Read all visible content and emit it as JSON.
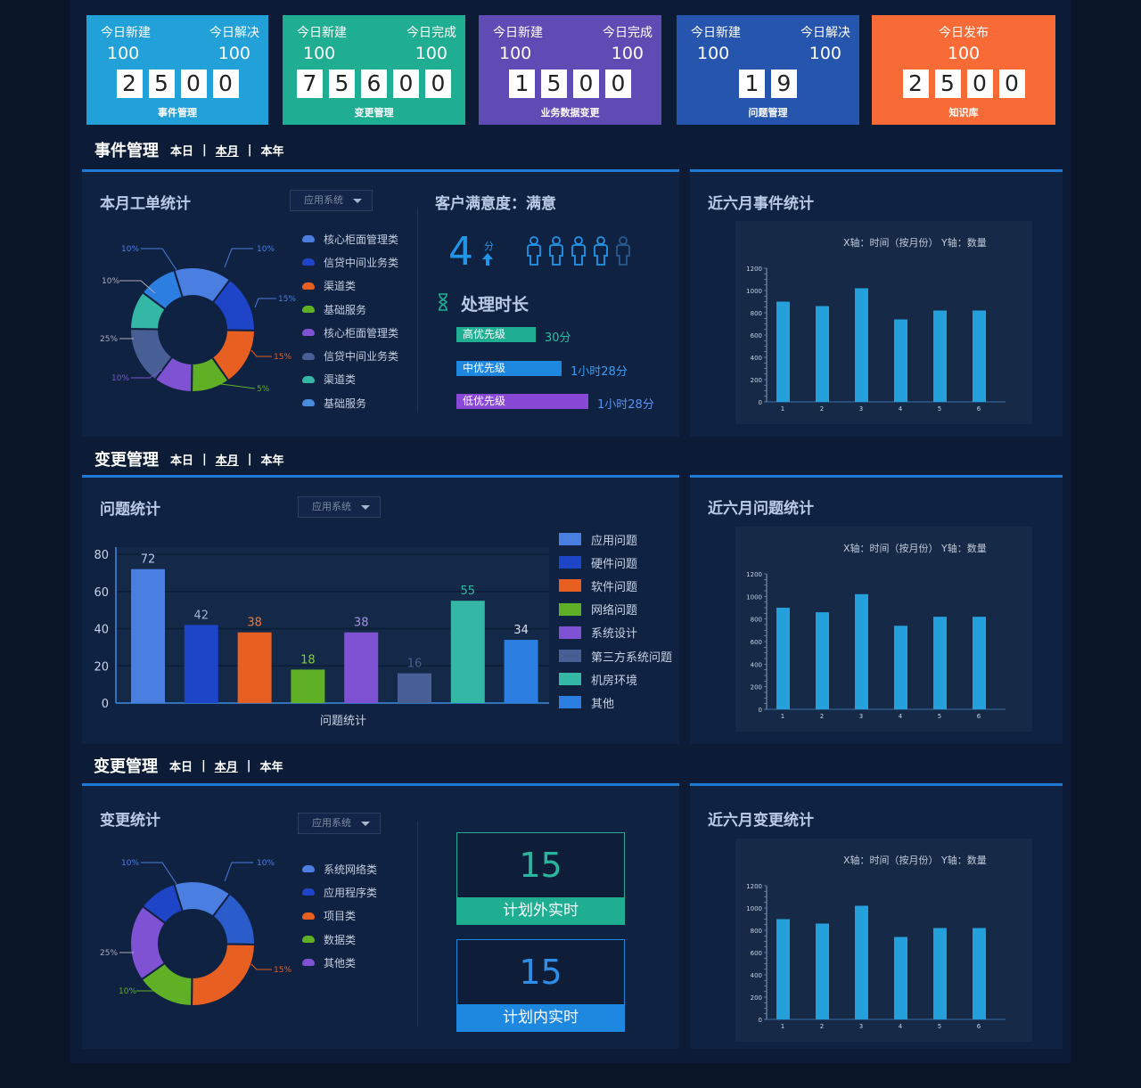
{
  "kpis": [
    {
      "left_label": "今日新建",
      "left_value": "100",
      "right_label": "今日解决",
      "right_value": "100",
      "digits": [
        "2",
        "5",
        "0",
        "0"
      ],
      "name": "事件管理",
      "color": "#22a0d8"
    },
    {
      "left_label": "今日新建",
      "left_value": "100",
      "right_label": "今日完成",
      "right_value": "100",
      "digits": [
        "7",
        "5",
        "6",
        "0",
        "0"
      ],
      "name": "变更管理",
      "color": "#1fae92"
    },
    {
      "left_label": "今日新建",
      "left_value": "100",
      "right_label": "今日完成",
      "right_value": "100",
      "digits": [
        "1",
        "5",
        "0",
        "0"
      ],
      "name": "业务数据变更",
      "color": "#5f4bb4"
    },
    {
      "left_label": "今日新建",
      "left_value": "100",
      "right_label": "今日解决",
      "right_value": "100",
      "digits": [
        "1",
        "9"
      ],
      "name": "问题管理",
      "color": "#2655ad"
    },
    {
      "center_label": "今日发布",
      "center_value": "100",
      "digits": [
        "2",
        "5",
        "0",
        "0"
      ],
      "name": "知识库",
      "color": "#f96b36"
    }
  ],
  "sections": [
    {
      "title": "事件管理",
      "filters": [
        "本日",
        "本月",
        "本年"
      ],
      "active": "本月"
    },
    {
      "title": "变更管理",
      "filters": [
        "本日",
        "本月",
        "本年"
      ],
      "active": "本月"
    },
    {
      "title": "变更管理",
      "filters": [
        "本日",
        "本月",
        "本年"
      ],
      "active": "本月"
    }
  ],
  "icons": {
    "hourglass": "hourglass-icon",
    "person": "person-icon",
    "arrow": "arrow-up-icon"
  },
  "panel1": {
    "title": "本月工单统计",
    "dropdown": "应用系统",
    "donut": {
      "labels": [
        "10%",
        "10%",
        "10%",
        "15%",
        "25%",
        "15%",
        "10%",
        "5%"
      ],
      "legend": [
        {
          "label": "核心柜面管理类",
          "color": "#4a7ee0"
        },
        {
          "label": "信贷中间业务类",
          "color": "#1e44c8"
        },
        {
          "label": "渠道类",
          "color": "#e85f22"
        },
        {
          "label": "基础服务",
          "color": "#60b025"
        },
        {
          "label": "核心柜面管理类",
          "color": "#7e52d2"
        },
        {
          "label": "信贷中间业务类",
          "color": "#485f96"
        },
        {
          "label": "渠道类",
          "color": "#35b7a6"
        },
        {
          "label": "基础服务",
          "color": "#4a8cdc"
        }
      ]
    },
    "satisfaction": {
      "title": "客户满意度：满意",
      "score": "4",
      "unit": "分",
      "people_filled": 4,
      "people_total": 5
    },
    "handling": {
      "title": "处理时长",
      "max": 40,
      "items": [
        {
          "label": "高优先级",
          "value": "30分",
          "minutes": 30,
          "color": "#1fae92",
          "text_color": "#2ac0a4"
        },
        {
          "label": "中优先级",
          "value": "1小时28分",
          "minutes": 40,
          "color": "#1e88e0",
          "text_color": "#3a9cf0"
        },
        {
          "label": "低优先级",
          "value": "1小时28分",
          "minutes": 50,
          "color": "#8a48d6",
          "text_color": "#5a92f0"
        }
      ]
    }
  },
  "panel2": {
    "title": "近六月事件统计",
    "axis_text": "X轴：时间（按月份）  Y轴：数量"
  },
  "panel3": {
    "title": "问题统计",
    "dropdown": "应用系统",
    "legend": [
      {
        "label": "应用问题",
        "color": "#4a7ee0"
      },
      {
        "label": "硬件问题",
        "color": "#1e44c8"
      },
      {
        "label": "软件问题",
        "color": "#e85f22"
      },
      {
        "label": "网络问题",
        "color": "#60b025"
      },
      {
        "label": "系统设计",
        "color": "#7e52d2"
      },
      {
        "label": "第三方系统问题",
        "color": "#485f96"
      },
      {
        "label": "机房环境",
        "color": "#35b7a6"
      },
      {
        "label": "其他",
        "color": "#2c7ee0"
      }
    ]
  },
  "panel4": {
    "title": "近六月问题统计",
    "axis_text": "X轴：时间（按月份）  Y轴：数量"
  },
  "panel5": {
    "title": "变更统计",
    "dropdown": "应用系统",
    "donut": {
      "labels": [
        "10%",
        "10%",
        "25%",
        "15%",
        "10%"
      ],
      "legend": [
        {
          "label": "系统网络类",
          "color": "#4a7ee0"
        },
        {
          "label": "应用程序类",
          "color": "#1e44c8"
        },
        {
          "label": "项目类",
          "color": "#e85f22"
        },
        {
          "label": "数据类",
          "color": "#60b025"
        },
        {
          "label": "其他类",
          "color": "#7e52d2"
        }
      ]
    },
    "box1": {
      "value": "15",
      "label": "计划外实时",
      "color": "#1fae92",
      "num_color": "#2ab59e"
    },
    "box2": {
      "value": "15",
      "label": "计划内实时",
      "color": "#1e88e0",
      "num_color": "#2e8ee8"
    }
  },
  "panel6": {
    "title": "近六月变更统计",
    "axis_text": "X轴：时间（按月份）  Y轴：数量"
  },
  "chart_data": [
    {
      "type": "pie",
      "donut": true,
      "values": [
        15,
        15,
        15,
        10,
        10,
        15,
        10,
        10
      ],
      "labels": [
        "10%",
        "10%",
        "10%",
        "15%",
        "25%",
        "15%",
        "10%",
        "5%"
      ],
      "legend": [
        "核心柜面管理类",
        "信贷中间业务类",
        "渠道类",
        "基础服务",
        "核心柜面管理类",
        "信贷中间业务类",
        "渠道类",
        "基础服务"
      ],
      "colors": [
        "#4a7ee0",
        "#1e44c8",
        "#e85f22",
        "#60b025",
        "#7e52d2",
        "#485f96",
        "#35b7a6",
        "#2c7ee0"
      ]
    },
    {
      "type": "bar",
      "categories": [
        "1",
        "2",
        "3",
        "4",
        "5",
        "6"
      ],
      "values": [
        900,
        860,
        1020,
        740,
        820,
        820
      ],
      "xlabel": "X轴：时间（按月份）",
      "ylabel": "Y轴：数量",
      "ylim": [
        0,
        1200
      ],
      "yticks": [
        0,
        200,
        400,
        600,
        800,
        1000,
        1200
      ],
      "color": "#24a0dc"
    },
    {
      "type": "bar",
      "xlabel": "问题统计",
      "categories": [
        "应用问题",
        "硬件问题",
        "软件问题",
        "网络问题",
        "系统设计",
        "第三方系统问题",
        "机房环境",
        "其他"
      ],
      "values": [
        72,
        42,
        38,
        18,
        38,
        16,
        55,
        34
      ],
      "ylim": [
        0,
        80
      ],
      "yticks": [
        0,
        20,
        40,
        60,
        80
      ],
      "colors": [
        "#4a7ee0",
        "#1e44c8",
        "#e85f22",
        "#60b025",
        "#7e52d2",
        "#485f96",
        "#35b7a6",
        "#2c7ee0"
      ],
      "label_colors": [
        "#b8c8e8",
        "#9fb0d8",
        "#f07a38",
        "#7ed030",
        "#a890e8",
        "#4a5e90",
        "#35b7a6",
        "#d8e0f0"
      ]
    },
    {
      "type": "bar",
      "categories": [
        "1",
        "2",
        "3",
        "4",
        "5",
        "6"
      ],
      "values": [
        900,
        860,
        1020,
        740,
        820,
        820
      ],
      "xlabel": "X轴：时间（按月份）",
      "ylabel": "Y轴：数量",
      "ylim": [
        0,
        1200
      ],
      "yticks": [
        0,
        200,
        400,
        600,
        800,
        1000,
        1200
      ],
      "color": "#24a0dc"
    },
    {
      "type": "pie",
      "donut": true,
      "values": [
        15,
        15,
        25,
        15,
        20,
        10
      ],
      "labels": [
        "10%",
        "10%",
        "25%",
        "15%",
        "10%"
      ],
      "legend": [
        "系统网络类",
        "应用程序类",
        "项目类",
        "数据类",
        "其他类"
      ],
      "colors": [
        "#4a7ee0",
        "#2a5ccc",
        "#e85f22",
        "#60b025",
        "#7e52d2",
        "#1e44c8"
      ]
    },
    {
      "type": "bar",
      "categories": [
        "1",
        "2",
        "3",
        "4",
        "5",
        "6"
      ],
      "values": [
        900,
        860,
        1020,
        740,
        820,
        820
      ],
      "xlabel": "X轴：时间（按月份）",
      "ylabel": "Y轴：数量",
      "ylim": [
        0,
        1200
      ],
      "yticks": [
        0,
        200,
        400,
        600,
        800,
        1000,
        1200
      ],
      "color": "#24a0dc"
    }
  ]
}
